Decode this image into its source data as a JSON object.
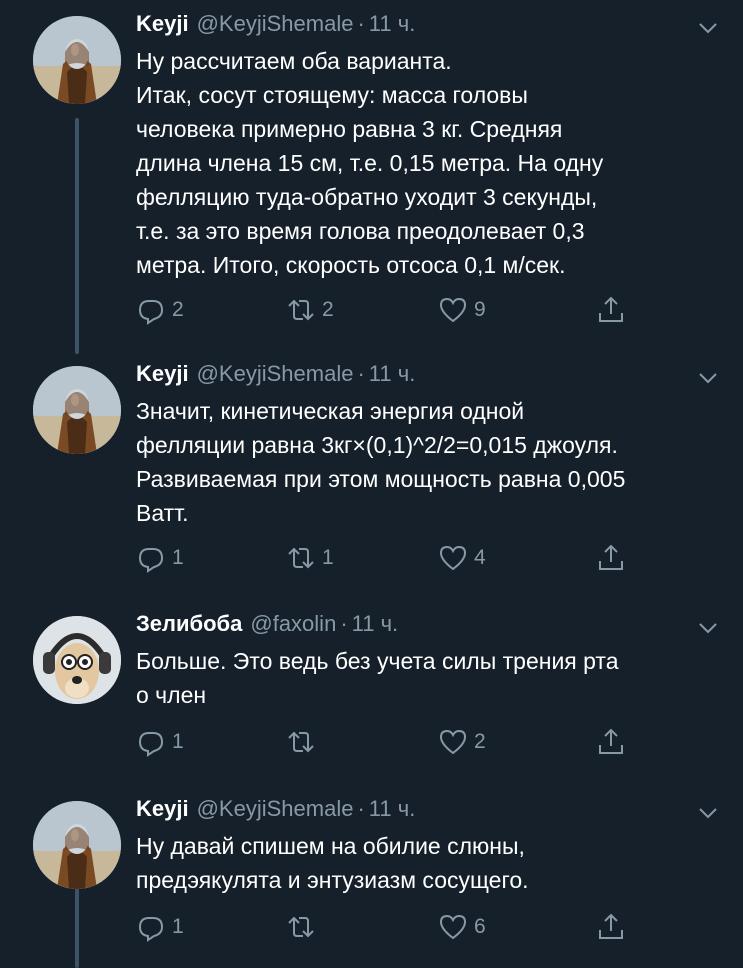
{
  "tweets": [
    {
      "name": "Keyji",
      "handle": "@KeyjiShemale",
      "time": "11 ч.",
      "lines": [
        "Ну рассчитаем оба варианта.",
        "Итак, сосут стоящему: масса головы",
        "человека примерно равна 3 кг. Средняя",
        "длина члена 15 см, т.е. 0,15 метра. На одну",
        "фелляцию туда-обратно уходит 3 секунды,",
        "т.е. за это время голова преодолевает 0,3",
        "метра. Итого, скорость отсоса 0,1 м/сек."
      ],
      "replies": "2",
      "retweets": "2",
      "likes": "9",
      "avatar": "hooded-figure"
    },
    {
      "name": "Keyji",
      "handle": "@KeyjiShemale",
      "time": "11 ч.",
      "lines": [
        "Значит, кинетическая энергия одной",
        "фелляции равна 3кг×(0,1)^2/2=0,015 джоуля.",
        "Развиваемая при этом мощность равна 0,005",
        "Ватт."
      ],
      "replies": "1",
      "retweets": "1",
      "likes": "4",
      "avatar": "hooded-figure"
    },
    {
      "name": "Зелибоба",
      "handle": "@faxolin",
      "time": "11 ч.",
      "lines": [
        "Больше. Это ведь без учета силы трения рта",
        "о член"
      ],
      "replies": "1",
      "retweets": "",
      "likes": "2",
      "avatar": "dog-with-headphones"
    },
    {
      "name": "Keyji",
      "handle": "@KeyjiShemale",
      "time": "11 ч.",
      "lines": [
        "Ну давай спишем на обилие слюны,",
        "предэякулята и энтузиазм сосущего."
      ],
      "replies": "1",
      "retweets": "",
      "likes": "6",
      "avatar": "hooded-figure"
    }
  ],
  "colors": {
    "background": "#15202b",
    "secondary_text": "#8899a6",
    "thread_line": "#3d5466"
  }
}
